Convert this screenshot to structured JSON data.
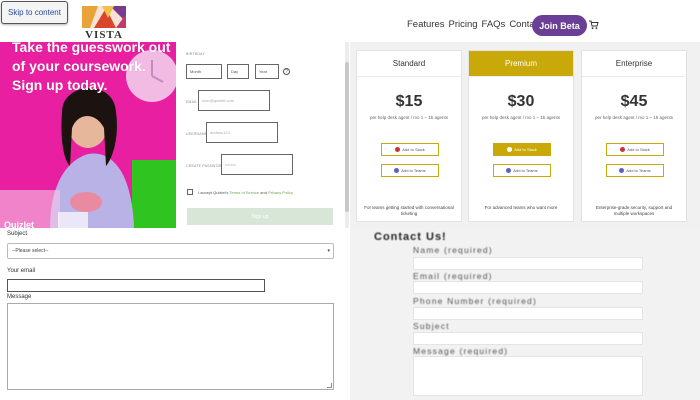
{
  "header": {
    "skip_link": "Skip to content",
    "logo_text": "VISTA",
    "nav": [
      "Features",
      "Pricing",
      "FAQs",
      "Contact"
    ],
    "join_label": "Join Beta",
    "cart_icon": "cart-icon"
  },
  "hero": {
    "headline_lines": [
      "Take the guesswork out",
      "of your coursework.",
      "Sign up today."
    ],
    "brand": "Quizlet"
  },
  "signup_form": {
    "birthday_label": "BIRTHDAY",
    "birthday_month": "Month",
    "birthday_day": "Day",
    "birthday_year": "Year",
    "email_label": "EMAIL",
    "email_placeholder": "user@quizlet.com",
    "username_label": "USERNAME",
    "username_placeholder": "andrew123",
    "password_label": "CREATE PASSWORD",
    "password_placeholder": "••••••••",
    "agree_prefix": "I accept Quizlet's ",
    "agree_terms": "Terms of Service",
    "agree_and": " and ",
    "agree_privacy": "Privacy Policy",
    "signup_button": "Sign up"
  },
  "pricing": {
    "plans": [
      {
        "name": "Standard",
        "price": "$15",
        "desc": "per help desk agent / mo 1 – 15 agents",
        "btn1": "Add to Slack",
        "btn2": "Add to Teams",
        "foot": "For teams getting started with conversational ticketing"
      },
      {
        "name": "Premium",
        "price": "$30",
        "desc": "per help desk agent / mo 1 – 15 agents",
        "btn1": "Add to Slack",
        "btn2": "Add to Teams",
        "foot": "For advanced teams who want more"
      },
      {
        "name": "Enterprise",
        "price": "$45",
        "desc": "per help desk agent / mo 1 – 15 agents",
        "btn1": "Add to Slack",
        "btn2": "Add to Teams",
        "foot": "Enterprise-grade security, support and multiple workspaces"
      }
    ],
    "accent": "#c9a90a"
  },
  "contact_form": {
    "subject_label": "Subject",
    "subject_value": "--Please select--",
    "email_label": "Your email",
    "message_label": "Message"
  },
  "contact_us": {
    "title": "Contact Us!",
    "fields": [
      "Name (required)",
      "Email (required)",
      "Phone Number (required)",
      "Subject",
      "Message (required)"
    ]
  },
  "colors": {
    "brand_purple": "#6b3f96",
    "hero_pink": "#e81fa0"
  }
}
